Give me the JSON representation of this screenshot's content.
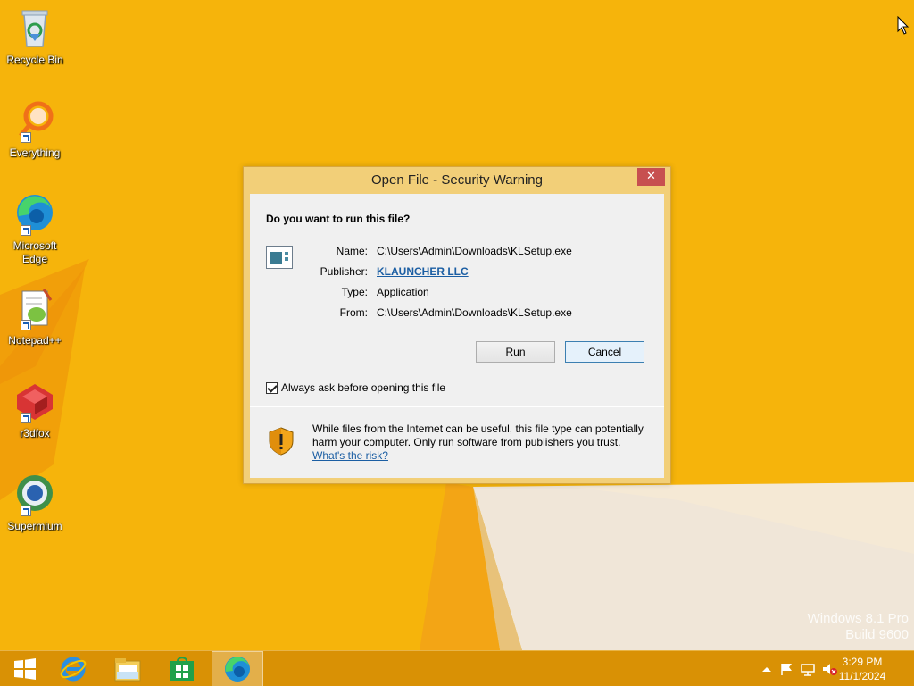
{
  "desktop": {
    "icons": [
      {
        "label": "Recycle Bin",
        "icon": "recycle-bin-icon"
      },
      {
        "label": "Everything",
        "icon": "everything-search-icon"
      },
      {
        "label": "Microsoft Edge",
        "icon": "edge-icon"
      },
      {
        "label": "Notepad++",
        "icon": "notepadpp-icon"
      },
      {
        "label": "r3dfox",
        "icon": "r3dfox-icon"
      },
      {
        "label": "Supermium",
        "icon": "supermium-icon"
      }
    ],
    "watermark": {
      "line1": "Windows 8.1 Pro",
      "line2": "Build 9600"
    }
  },
  "dialog": {
    "title": "Open File - Security Warning",
    "close_glyph": "✕",
    "question": "Do you want to run this file?",
    "fields": {
      "name_label": "Name:",
      "name_value": "C:\\Users\\Admin\\Downloads\\KLSetup.exe",
      "publisher_label": "Publisher:",
      "publisher_value": "KLAUNCHER LLC",
      "type_label": "Type:",
      "type_value": "Application",
      "from_label": "From:",
      "from_value": "C:\\Users\\Admin\\Downloads\\KLSetup.exe"
    },
    "run_label": "Run",
    "cancel_label": "Cancel",
    "checkbox_label": "Always ask before opening this file",
    "checkbox_checked": true,
    "warning_text": "While files from the Internet can be useful, this file type can potentially harm your computer. Only run software from publishers you trust.",
    "risk_link": "What's the risk?"
  },
  "taskbar": {
    "items": [
      {
        "icon": "start-icon"
      },
      {
        "icon": "internet-explorer-icon"
      },
      {
        "icon": "file-explorer-icon"
      },
      {
        "icon": "store-icon"
      },
      {
        "icon": "edge-icon",
        "active": true
      }
    ],
    "tray": [
      "show-hidden-icons",
      "action-center-flag-icon",
      "network-icon",
      "volume-muted-icon"
    ],
    "clock": {
      "time": "3:29 PM",
      "date": "11/1/2024"
    }
  },
  "colors": {
    "wallpaper": "#f6b40b",
    "taskbar": "#d68e05",
    "link": "#1b5ea3",
    "close_button": "#c75050"
  }
}
